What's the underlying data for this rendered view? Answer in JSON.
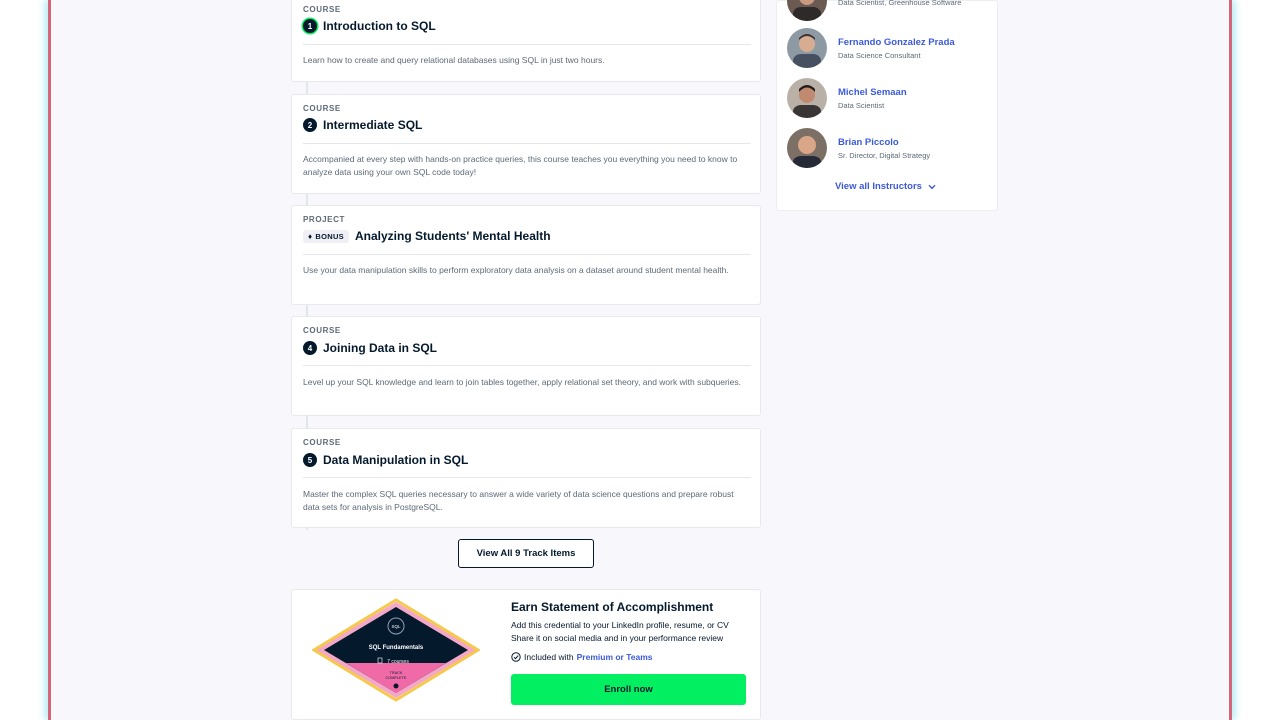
{
  "track_items": [
    {
      "type": "COURSE",
      "number": "1",
      "title": "Introduction to SQL",
      "description": "Learn how to create and query relational databases using SQL in just two hours."
    },
    {
      "type": "COURSE",
      "number": "2",
      "title": "Intermediate SQL",
      "description": "Accompanied at every step with hands-on practice queries, this course teaches you everything you need to know to analyze data using your own SQL code today!"
    },
    {
      "type": "PROJECT",
      "bonus_label": "BONUS",
      "title": "Analyzing Students' Mental Health",
      "description": "Use your data manipulation skills to perform exploratory data analysis on a dataset around student mental health."
    },
    {
      "type": "COURSE",
      "number": "4",
      "title": "Joining Data in SQL",
      "description": "Level up your SQL knowledge and learn to join tables together, apply relational set theory, and work with subqueries."
    },
    {
      "type": "COURSE",
      "number": "5",
      "title": "Data Manipulation in SQL",
      "description": "Master the complex SQL queries necessary to answer a wide variety of data science questions and prepare robust data sets for analysis in PostgreSQL."
    }
  ],
  "view_all_label": "View All 9 Track Items",
  "accomplishment": {
    "heading": "Earn Statement of Accomplishment",
    "line1": "Add this credential to your LinkedIn profile, resume, or CV",
    "line2": "Share it on social media and in your performance review",
    "included_prefix": "Included with",
    "included_link": "Premium or Teams",
    "enroll_label": "Enroll now",
    "badge": {
      "tag": "SQL",
      "title": "SQL Fundamentals",
      "courses": "7 courses",
      "status_line1": "TRACK",
      "status_line2": "COMPLETE"
    }
  },
  "instructors": [
    {
      "name": "",
      "role": "Data Scientist, Greenhouse Software"
    },
    {
      "name": "Fernando Gonzalez Prada",
      "role": "Data Science Consultant"
    },
    {
      "name": "Michel Semaan",
      "role": "Data Scientist"
    },
    {
      "name": "Brian Piccolo",
      "role": "Sr. Director, Digital Strategy"
    }
  ],
  "view_all_instructors_label": "View all Instructors",
  "colors": {
    "accent_green": "#03ef62",
    "link_blue": "#3b5ad8",
    "navy": "#05192d"
  }
}
